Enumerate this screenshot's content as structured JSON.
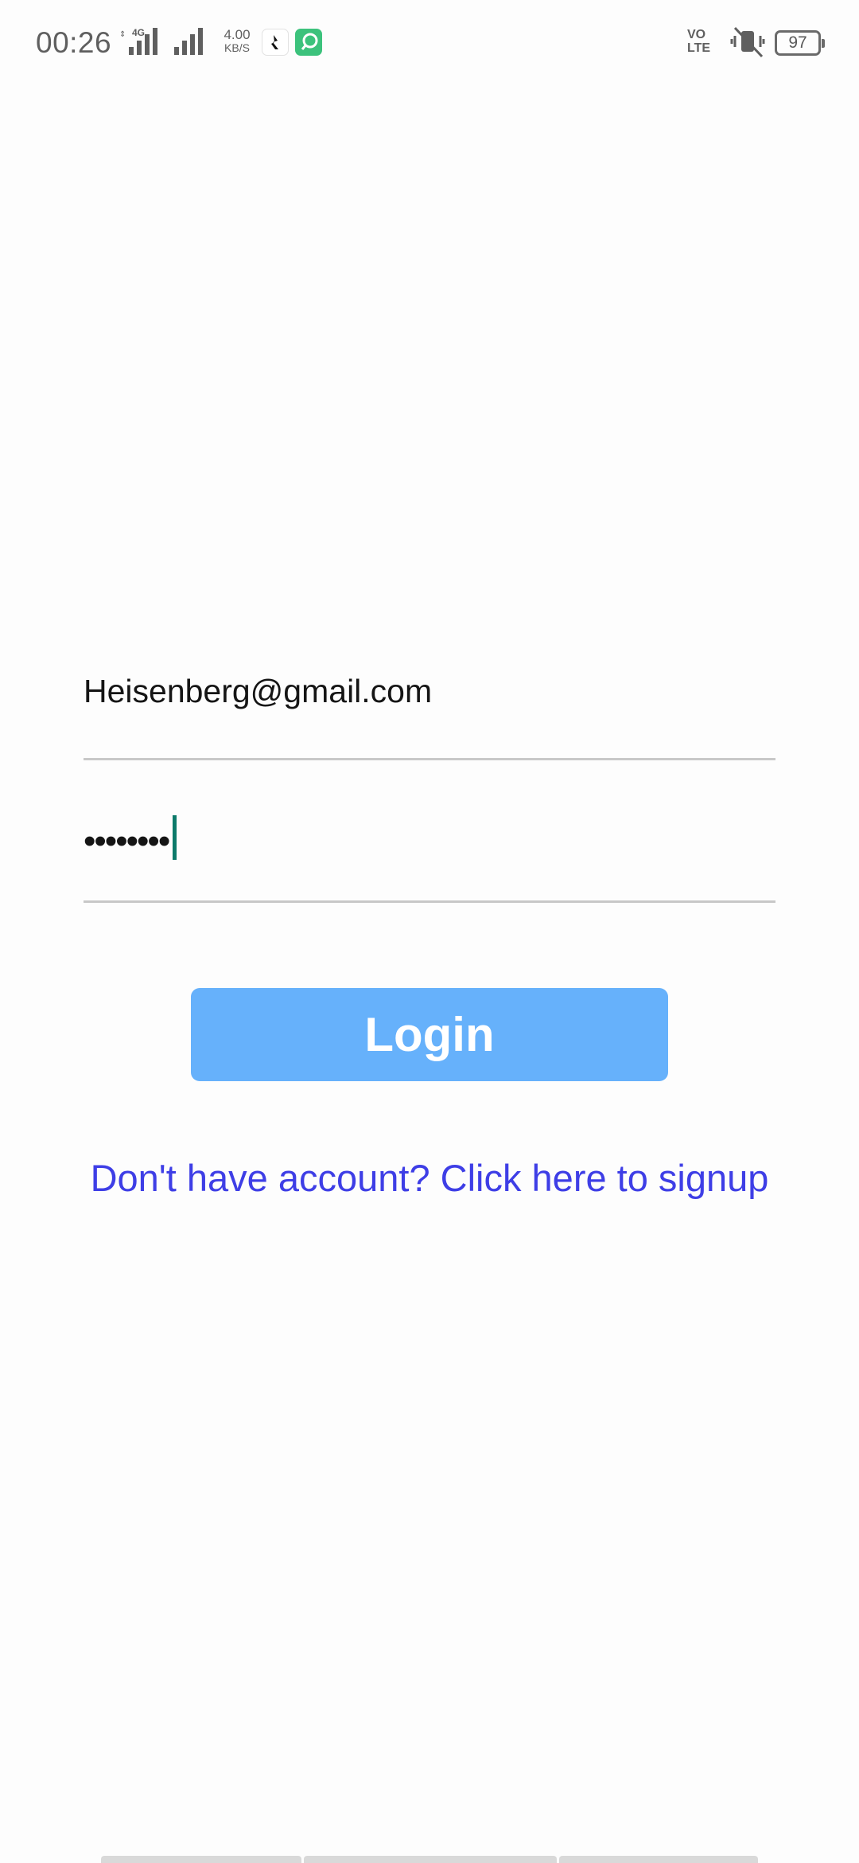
{
  "status_bar": {
    "time": "00:26",
    "network_type": "4G",
    "speed_value": "4.00",
    "speed_unit": "KB/S",
    "volte_top": "VO",
    "volte_bottom": "LTE",
    "battery_level": "97",
    "icons": [
      "signal-icon",
      "signal-icon",
      "app-notification-icon",
      "app-notification-icon",
      "volte-icon",
      "mute-icon",
      "battery-icon"
    ]
  },
  "login_form": {
    "email_value": "Heisenberg@gmail.com",
    "password_mask": "••••••••",
    "login_label": "Login",
    "signup_text": "Don't have account? Click here to signup"
  },
  "colors": {
    "button": "#66b1fb",
    "link": "#3e3ee6",
    "cursor": "#0c7a6a"
  }
}
